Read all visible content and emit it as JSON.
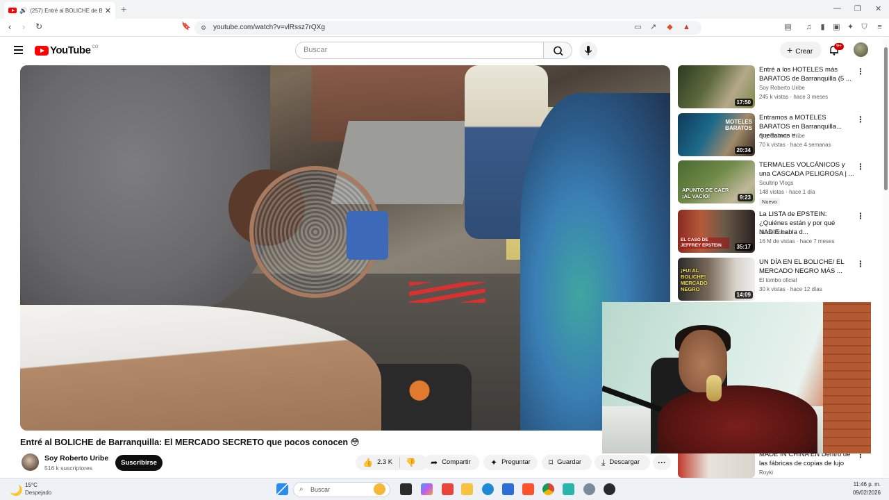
{
  "browser": {
    "tab_title": "(257) Entré al BOLICHE de Ba",
    "url": "youtube.com/watch?v=vlRssz7rQXg"
  },
  "youtube": {
    "logo_text": "YouTube",
    "country": "CO",
    "search_placeholder": "Buscar",
    "create_label": "Crear",
    "notifications_badge": "9+"
  },
  "video": {
    "title": "Entré al BOLICHE de Barranquilla: El MERCADO SECRETO que pocos conocen 😳",
    "channel": "Soy Roberto Uribe",
    "subscribers": "516 k suscriptores",
    "subscribe_label": "Suscribirse",
    "likes": "2.3 K",
    "share_label": "Compartir",
    "ask_label": "Preguntar",
    "save_label": "Guardar",
    "download_label": "Descargar"
  },
  "recommendations": [
    {
      "title": "Entré a los HOTELES más BARATOS de Barranquilla (5 ...",
      "channel": "Soy Roberto Uribe",
      "meta": "245 k vistas · hace 3 meses",
      "duration": "17:50"
    },
    {
      "title": "Entramos a MOTELES BARATOS en Barranquilla... quedamos e...",
      "channel": "Soy Roberto Uribe",
      "meta": "70 k vistas · hace 4 semanas",
      "duration": "20:34",
      "thumb_text": "MOTELES BARATOS"
    },
    {
      "title": "TERMALES VOLCÁNICOS y una CASCADA PELIGROSA | ...",
      "channel": "Soultrip Vlogs",
      "meta": "148 vistas · hace 1 día",
      "duration": "9:23",
      "badge": "Nuevo",
      "thumb_text": "APUNTO DE CAER ¡AL VACÍO!"
    },
    {
      "title": "La LISTA de EPSTEIN: ¿Quiénes están y por qué NADIE habla d...",
      "channel": "Dieck Docs",
      "meta": "16 M de vistas · hace 7 meses",
      "duration": "35:17",
      "thumb_text": "EL CASO DE JEFFREY EPSTEIN"
    },
    {
      "title": "UN DÍA EN EL BOLICHE/ EL MERCADO NEGRO MÁS ...",
      "channel": "El tombo oficial",
      "meta": "30 k vistas · hace 12 días",
      "duration": "14:09",
      "thumb_text": "¡FUI AL BOLICHE! MERCADO NEGRO"
    },
    {
      "title": "MADE IN CHINA EN Dentro de las fábricas de copias de lujo",
      "channel": "Royki"
    }
  ],
  "taskbar": {
    "temperature": "15°C",
    "condition": "Despejado",
    "search_placeholder": "Buscar",
    "time": "11:46 p. m.",
    "date": "09/02/2026"
  }
}
